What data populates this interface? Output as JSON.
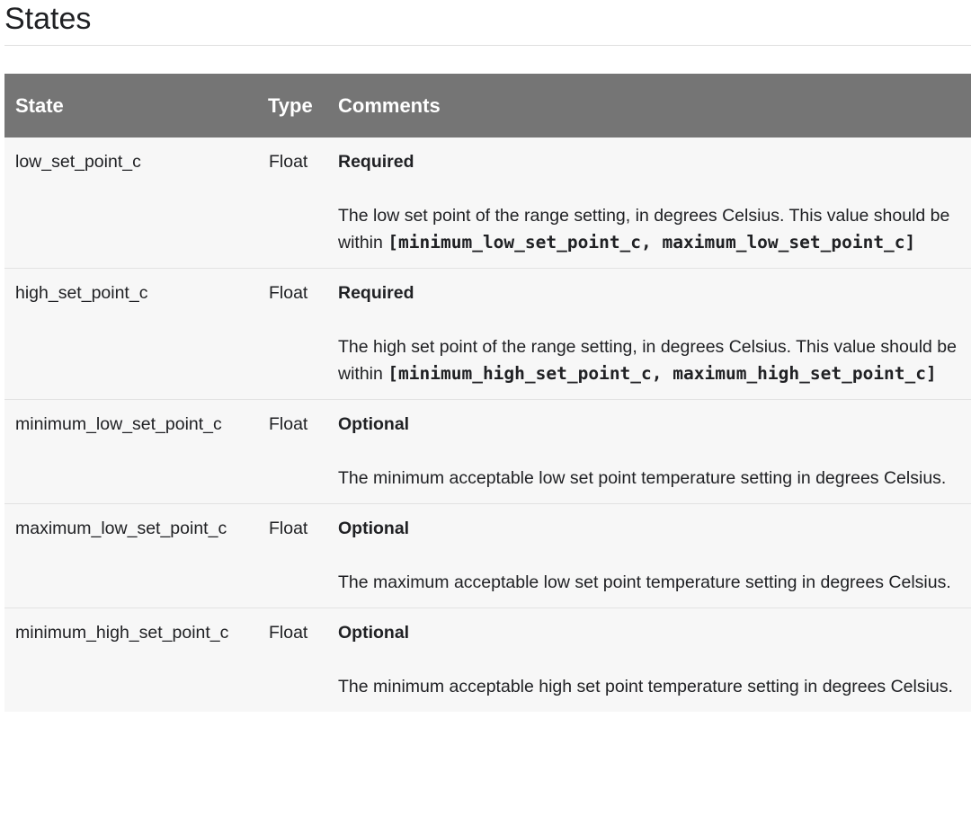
{
  "heading": "States",
  "table": {
    "columns": [
      "State",
      "Type",
      "Comments"
    ],
    "rows": [
      {
        "state": "low_set_point_c",
        "type": "Float",
        "requirement": "Required",
        "desc_pre": "The low set point of the range setting, in degrees Celsius. This value should be within ",
        "code": "[minimum_low_set_point_c, maximum_low_set_point_c]",
        "desc_post": ""
      },
      {
        "state": "high_set_point_c",
        "type": "Float",
        "requirement": "Required",
        "desc_pre": "The high set point of the range setting, in degrees Celsius. This value should be within ",
        "code": "[minimum_high_set_point_c, maximum_high_set_point_c]",
        "desc_post": ""
      },
      {
        "state": "minimum_low_set_point_c",
        "type": "Float",
        "requirement": "Optional",
        "desc_pre": "The minimum acceptable low set point temperature setting in degrees Celsius.",
        "code": "",
        "desc_post": ""
      },
      {
        "state": "maximum_low_set_point_c",
        "type": "Float",
        "requirement": "Optional",
        "desc_pre": "The maximum acceptable low set point temperature setting in degrees Celsius.",
        "code": "",
        "desc_post": ""
      },
      {
        "state": "minimum_high_set_point_c",
        "type": "Float",
        "requirement": "Optional",
        "desc_pre": "The minimum acceptable high set point temperature setting in degrees Celsius.",
        "code": "",
        "desc_post": ""
      }
    ]
  },
  "colors": {
    "header_bg": "#757575",
    "row_bg": "#f7f7f7",
    "text": "#202124"
  }
}
